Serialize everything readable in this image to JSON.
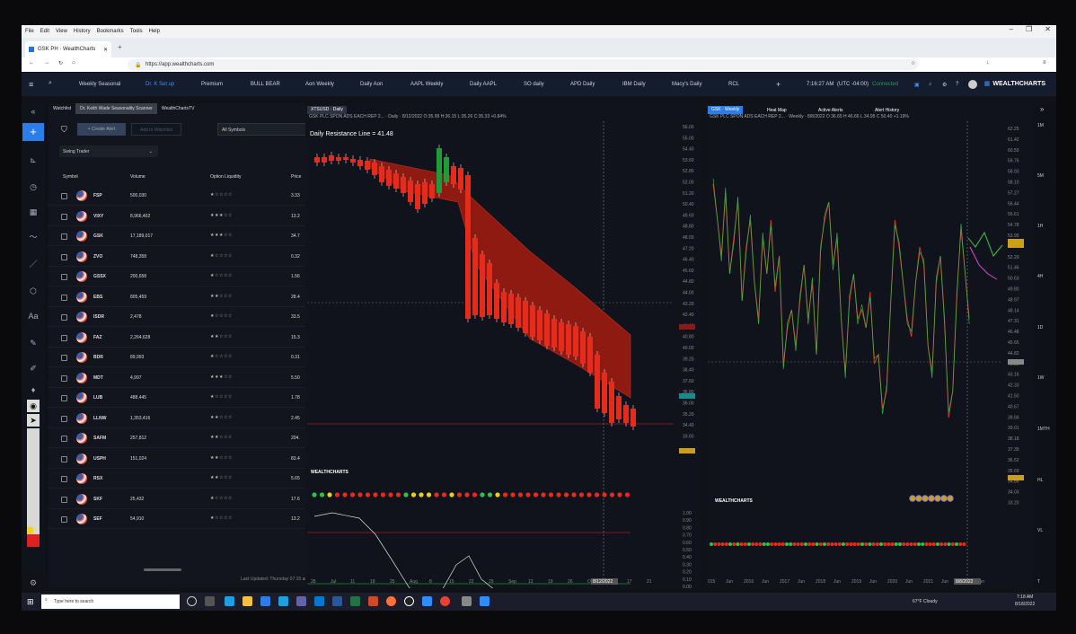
{
  "browser": {
    "menu": [
      "File",
      "Edit",
      "View",
      "History",
      "Bookmarks",
      "Tools",
      "Help"
    ],
    "tab_title": "GSK PH · WealthCharts",
    "url": "https://app.wealthcharts.com"
  },
  "app": {
    "tabs": [
      "Weekly Seasonal",
      "Dr. K Set up",
      "Premium",
      "BULL BEAR",
      "Aon Weekly",
      "Daily Aon",
      "AAPL Weekly",
      "Daily AAPL",
      "SO daily",
      "APD Daily",
      "IBM Daily",
      "Macy's Daily",
      "RCL"
    ],
    "time": "7:16:27 AM",
    "tz": "(UTC -04:00)",
    "status": "Connected",
    "brand": "WEALTHCHARTS"
  },
  "watchlist": {
    "tabs": [
      "Watchlist",
      "Dr. Keith Wade Seasonality Scanner",
      "WealthChartsTV"
    ],
    "create_alert": "+ Create Alert",
    "add_to_watchlist": "Add to Watchlist",
    "symbol_filter": "All Symbols",
    "strategy": "Swing Trader",
    "columns": [
      "Symbol",
      "Volume",
      "Option Liquidity",
      "Price"
    ],
    "rows": [
      {
        "sym": "FSP",
        "vol": "500,030",
        "liq": "★☆☆☆☆",
        "price": "3.33"
      },
      {
        "sym": "VIXY",
        "vol": "8,966,402",
        "liq": "★★★☆☆",
        "price": "13.2"
      },
      {
        "sym": "GSK",
        "vol": "17,189,017",
        "liq": "★★★☆☆",
        "price": "34.7"
      },
      {
        "sym": "ZVO",
        "vol": "748,358",
        "liq": "★☆☆☆☆",
        "price": "0.32"
      },
      {
        "sym": "GSSX",
        "vol": "200,658",
        "liq": "★☆☆☆☆",
        "price": "1.56"
      },
      {
        "sym": "EBS",
        "vol": "805,459",
        "liq": "★★☆☆☆",
        "price": "28.4"
      },
      {
        "sym": "ISDR",
        "vol": "2,478",
        "liq": "★☆☆☆☆",
        "price": "33.5"
      },
      {
        "sym": "FAZ",
        "vol": "2,264,628",
        "liq": "★★☆☆☆",
        "price": "15.3"
      },
      {
        "sym": "BDR",
        "vol": "89,993",
        "liq": "★☆☆☆☆",
        "price": "0.31"
      },
      {
        "sym": "MDT",
        "vol": "4,997",
        "liq": "★★★☆☆",
        "price": "5.50"
      },
      {
        "sym": "LUB",
        "vol": "488,445",
        "liq": "★☆☆☆☆",
        "price": "1.78"
      },
      {
        "sym": "LLNW",
        "vol": "1,353,416",
        "liq": "★★☆☆☆",
        "price": "2.45"
      },
      {
        "sym": "SAFM",
        "vol": "257,812",
        "liq": "★★☆☆☆",
        "price": "204."
      },
      {
        "sym": "USPH",
        "vol": "151,024",
        "liq": "★★☆☆☆",
        "price": "83.4"
      },
      {
        "sym": "RSX",
        "vol": "",
        "liq": "★★☆☆☆",
        "price": "5.65"
      },
      {
        "sym": "SKF",
        "vol": "25,432",
        "liq": "★☆☆☆☆",
        "price": "17.6"
      },
      {
        "sym": "SEF",
        "vol": "54,910",
        "liq": "★☆☆☆☆",
        "price": "13.2"
      }
    ],
    "last_updated": "Last Updated: Thursday 07:15 am"
  },
  "chart1": {
    "tag": "XTSUSD · Daily",
    "header": "GSK PLC SPON ADS EACH REP 2... · Daily · 8/12/2022 O:35.99 H:36.15 L:35.26 C:35.33 +0.84%",
    "resistance": "Daily Resistance Line = 41.48",
    "yticks": [
      "56.00",
      "55.00",
      "54.40",
      "53.60",
      "52.80",
      "52.00",
      "51.20",
      "50.40",
      "49.60",
      "48.80",
      "48.00",
      "47.20",
      "46.40",
      "45.60",
      "44.80",
      "44.00",
      "43.20",
      "42.40",
      "41.60",
      "40.80",
      "40.00",
      "39.20",
      "38.40",
      "37.60",
      "36.80",
      "36.00",
      "35.20",
      "34.40",
      "33.60"
    ],
    "xticks": [
      "28",
      "Jul",
      "11",
      "18",
      "25",
      "Aug",
      "8",
      "15",
      "22",
      "29",
      "Sep",
      "12",
      "19",
      "26",
      "Oct",
      "10",
      "17",
      "21"
    ],
    "date_badge": "8/12/2022",
    "osc_ticks": [
      "1.00",
      "0.90",
      "0.80",
      "0.70",
      "0.60",
      "0.50",
      "0.40",
      "0.30",
      "0.20",
      "0.10",
      "0.00"
    ]
  },
  "chart2": {
    "tag": "GSK · Weekly",
    "tabs": [
      "Heat Map",
      "Active Alerts",
      "Alert History"
    ],
    "header": "GSK PLC SPON ADS EACH REP 2... · Weekly · 8/8/2022 O 36.65 H 46.66 L 34.95 C 50.40 +1.19%",
    "yticks": [
      "62.25",
      "61.42",
      "60.59",
      "59.76",
      "58.93",
      "58.10",
      "57.27",
      "56.44",
      "55.61",
      "54.78",
      "53.95",
      "53.12",
      "52.29",
      "51.46",
      "50.63",
      "49.80",
      "48.97",
      "48.14",
      "47.31",
      "46.48",
      "45.65",
      "44.82",
      "43.99",
      "43.16",
      "42.33",
      "41.50",
      "40.67",
      "39.84",
      "39.01",
      "38.18",
      "37.35",
      "36.52",
      "35.69",
      "34.86",
      "34.03",
      "33.20"
    ],
    "xticks": [
      "015",
      "Jun",
      "2016",
      "Jun",
      "2017",
      "Jun",
      "2018",
      "Jun",
      "2019",
      "Jun",
      "2020",
      "Jun",
      "2021",
      "Jun",
      "2022",
      "Jun"
    ],
    "date_badge": "8/8/2022"
  },
  "timeframes": [
    "1M",
    "5M",
    "1H",
    "4H",
    "1D",
    "1W",
    "1MTH",
    "HL",
    "VL",
    "T"
  ],
  "taskbar": {
    "search": "Type here to search",
    "weather": "67°F Cloudy",
    "clock_time": "7:18 AM",
    "clock_date": "8/18/2022"
  }
}
